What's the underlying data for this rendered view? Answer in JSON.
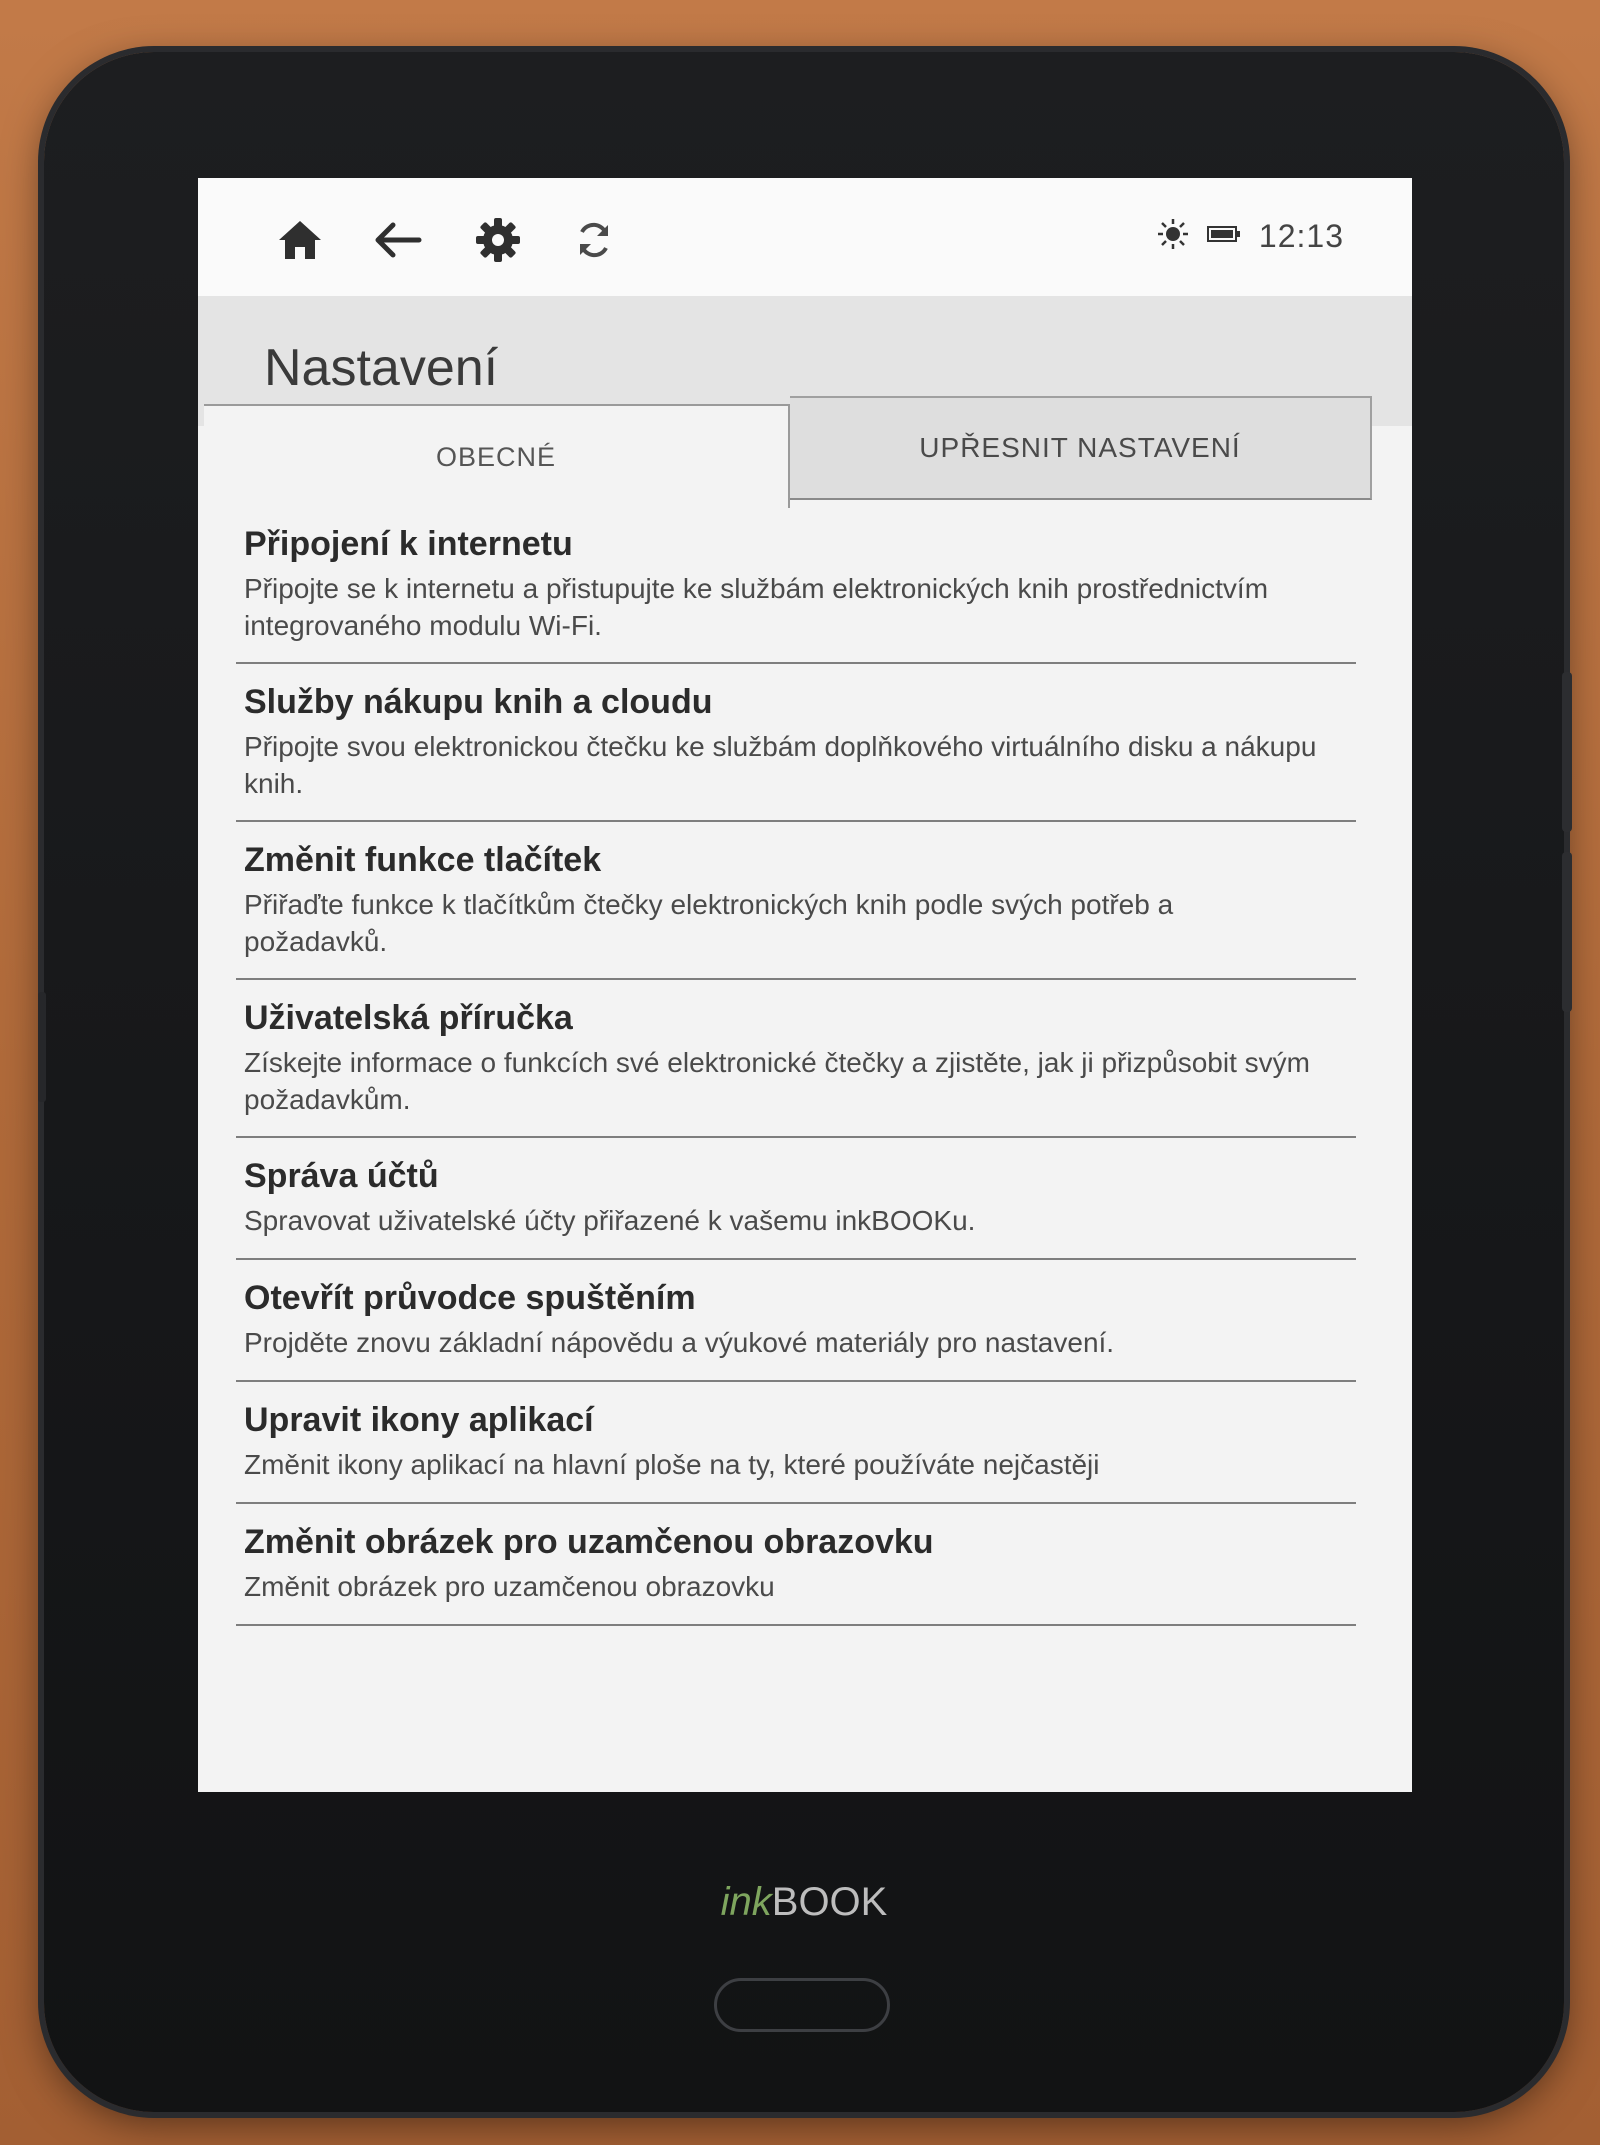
{
  "device": {
    "brand_prefix": "ink",
    "brand_suffix": "BOOK"
  },
  "topbar": {
    "icons": [
      "home-icon",
      "back-arrow-icon",
      "settings-gear-icon",
      "sync-icon"
    ],
    "status_icons": [
      "brightness-icon",
      "battery-icon"
    ],
    "time": "12:13"
  },
  "header": {
    "title": "Nastavení"
  },
  "tabs": [
    {
      "label": "OBECNÉ",
      "active": true
    },
    {
      "label": "UPŘESNIT NASTAVENÍ",
      "active": false
    }
  ],
  "items": [
    {
      "title": "Připojení k internetu",
      "description": "Připojte se k internetu a přistupujte ke službám elektronických knih prostřednictvím integrovaného modulu Wi-Fi."
    },
    {
      "title": "Služby nákupu knih a cloudu",
      "description": "Připojte svou elektronickou čtečku ke službám doplňkového virtuálního disku a nákupu knih."
    },
    {
      "title": "Změnit funkce tlačítek",
      "description": "Přiřaďte funkce k tlačítkům čtečky elektronických knih podle svých potřeb a požadavků."
    },
    {
      "title": "Uživatelská příručka",
      "description": "Získejte informace o funkcích své elektronické čtečky a zjistěte, jak ji přizpůsobit svým požadavkům."
    },
    {
      "title": "Správa účtů",
      "description": "Spravovat uživatelské účty přiřazené k vašemu inkBOOKu."
    },
    {
      "title": "Otevřít průvodce spuštěním",
      "description": "Projděte znovu základní nápovědu a výukové materiály pro nastavení."
    },
    {
      "title": "Upravit ikony aplikací",
      "description": "Změnit ikony aplikací na hlavní ploše na ty, které používáte nejčastěji"
    },
    {
      "title": "Změnit obrázek pro uzamčenou obrazovku",
      "description": "Změnit obrázek pro uzamčenou obrazovku"
    }
  ]
}
